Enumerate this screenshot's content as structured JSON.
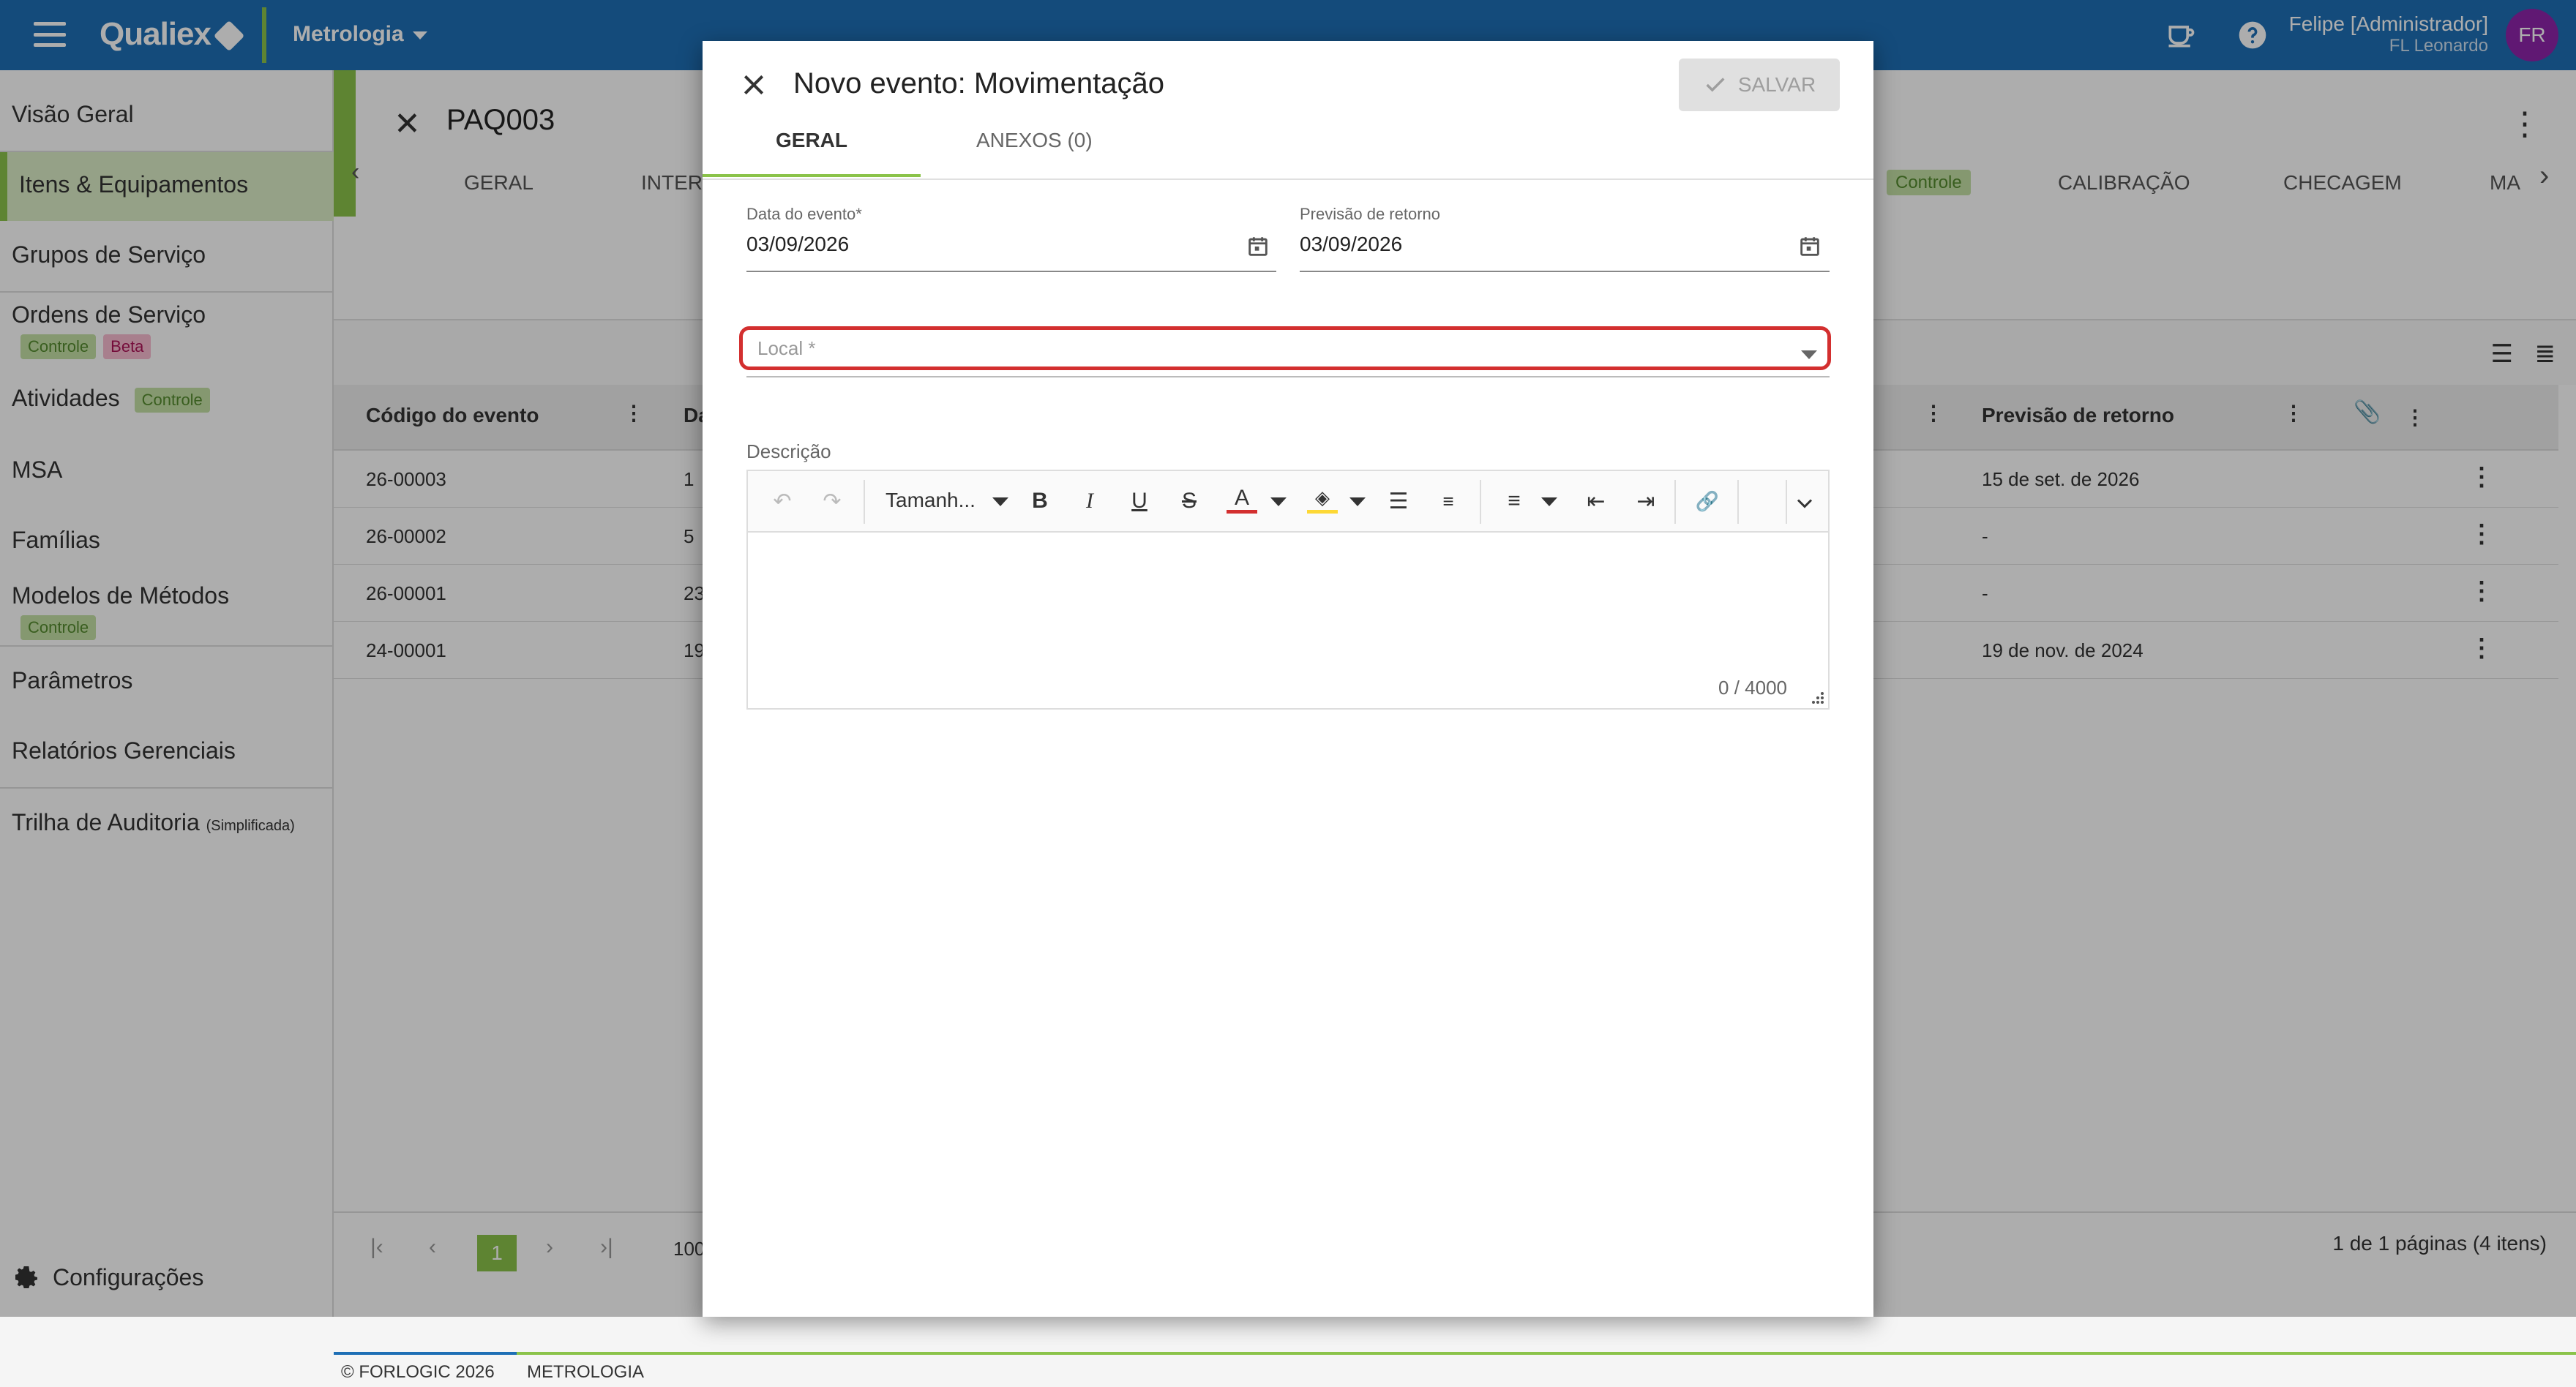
{
  "topbar": {
    "logo": "Qualiex",
    "module": "Metrologia",
    "user_name": "Felipe [Administrador]",
    "user_sub": "FL Leonardo",
    "avatar": "FR"
  },
  "sidebar": {
    "items": [
      {
        "label": "Visão Geral"
      },
      {
        "label": "Itens & Equipamentos"
      },
      {
        "label": "Grupos de Serviço"
      },
      {
        "label": "Ordens de Serviço",
        "badges": [
          "Controle",
          "Beta"
        ]
      },
      {
        "label": "Atividades",
        "badges": [
          "Controle"
        ]
      },
      {
        "label": "MSA"
      },
      {
        "label": "Famílias"
      },
      {
        "label": "Modelos de Métodos",
        "badges": [
          "Controle"
        ]
      },
      {
        "label": "Parâmetros"
      },
      {
        "label": "Relatórios Gerenciais"
      },
      {
        "label": "Trilha de Auditoria",
        "suffix": "(Simplificada)"
      }
    ],
    "config": "Configurações"
  },
  "record": {
    "title": "PAQ003",
    "tabs": [
      "GERAL",
      "INTER",
      "Controle",
      "CALIBRAÇÃO",
      "CHECAGEM",
      "MA"
    ]
  },
  "table": {
    "headers": [
      "Código do evento",
      "Da",
      "Previsão de retorno"
    ],
    "rows": [
      {
        "code": "26-00003",
        "date": "1",
        "return": "15 de set. de 2026"
      },
      {
        "code": "26-00002",
        "date": "5",
        "return": "-"
      },
      {
        "code": "26-00001",
        "date": "23",
        "return": "-"
      },
      {
        "code": "24-00001",
        "date": "19",
        "return": "19 de nov. de 2024"
      }
    ],
    "page": "1",
    "page_size": "100",
    "page_info": "1 de 1 páginas (4 itens)"
  },
  "footer": {
    "copyright": "© FORLOGIC 2026",
    "module": "METROLOGIA"
  },
  "modal": {
    "title": "Novo evento: Movimentação",
    "save": "SALVAR",
    "tabs": [
      "GERAL",
      "ANEXOS (0)"
    ],
    "event_date_label": "Data do evento*",
    "event_date": "03/09/2026",
    "return_label": "Previsão de retorno",
    "return_date": "03/09/2026",
    "local_label": "Local *",
    "desc_label": "Descrição",
    "font_size": "Tamanh...",
    "counter": "0 / 4000"
  }
}
